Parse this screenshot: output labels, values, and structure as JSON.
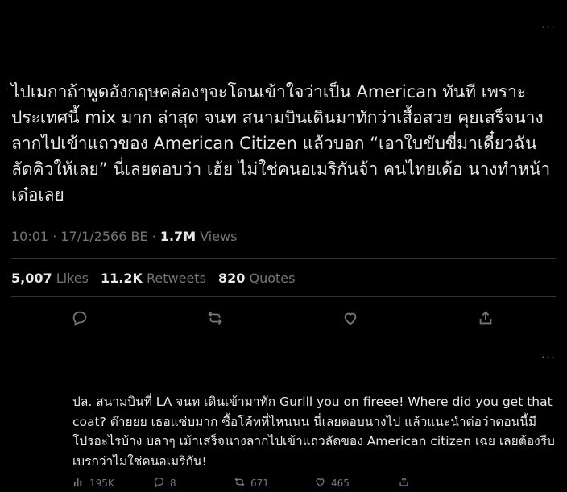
{
  "main_tweet": {
    "more_label": "···",
    "text": "ไปเมกาถ้าพูดอังกฤษคล่องๆจะโดนเข้าใจว่าเป็น American ทันที เพราะประเทศนี้ mix มาก ล่าสุด จนท สนามบินเดินมาทักว่าเสื้อสวย คุยเสร็จนางลากไปเข้าแถวของ American Citizen แล้วบอก “เอาใบขับขี่มาเดี๋ยวฉันลัดคิวให้เลย” นี่เลยตอบว่า เฮ้ย ไม่ใช่คนอเมริกันจ้า คนไทยเด้อ นางทำหน้าเด๋อเลย",
    "time": "10:01 · 17/1/2566 BE · ",
    "views_count": "1.7M",
    "views_label": " Views",
    "stats": {
      "likes_count": "5,007",
      "likes_label": "Likes",
      "retweets_count": "11.2K",
      "retweets_label": "Retweets",
      "quotes_count": "820",
      "quotes_label": "Quotes"
    },
    "icons": [
      "reply-icon",
      "retweet-icon",
      "like-icon",
      "share-icon"
    ]
  },
  "reply": {
    "more_label": "···",
    "text": "ปล. สนามบินที่ LA จนท เดินเข้ามาทัก Gurlll you on fireee! Where did you get that coat? ต๊ายยย เธอแซ่บมาก ซื้อโค้ทที่ไหนนน นี่เลยตอบนางไป แล้วแนะนำต่อว่าตอนนี้มีโปรอะไรบ้าง บลาๆ เม้าเสร็จนางลากไปเข้าแถวลัดของ American citizen เฉย เลยต้องรีบเบรกว่าไม่ใช่คนอเมริกัน!",
    "views": "195K",
    "replies": "8",
    "retweets": "671",
    "likes": "465"
  },
  "colors": {
    "background": "#000000",
    "text": "#e7e9ea",
    "secondary": "#71767b",
    "divider": "#2f3336"
  }
}
